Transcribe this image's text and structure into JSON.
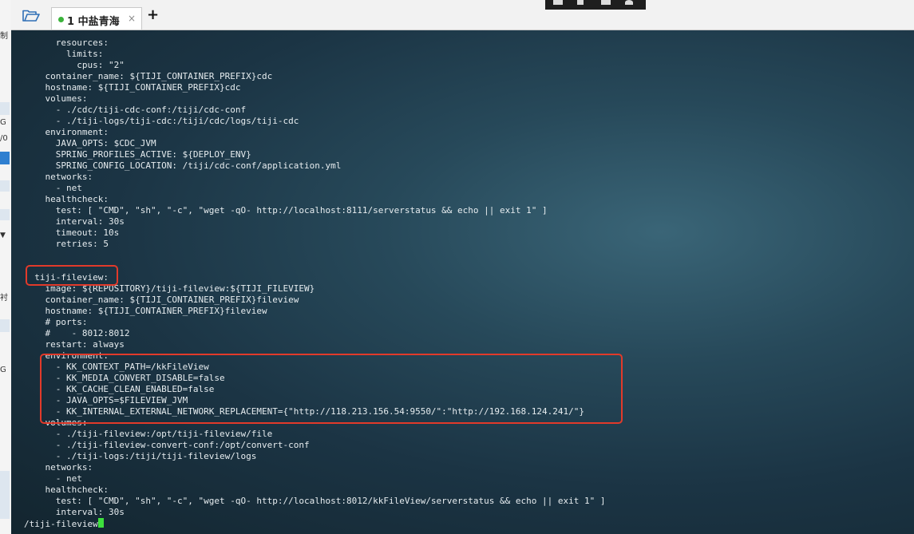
{
  "tabs": [
    {
      "label": "1 中盐青海",
      "active": true,
      "status_color": "#3bb33b"
    }
  ],
  "tab_close_glyph": "×",
  "add_tab_glyph": "+",
  "left_fragments": [
    "制",
    "G",
    "/0",
    "衬",
    "G"
  ],
  "terminal": {
    "lines": [
      "      resources:",
      "        limits:",
      "          cpus: \"2\"",
      "    container_name: ${TIJI_CONTAINER_PREFIX}cdc",
      "    hostname: ${TIJI_CONTAINER_PREFIX}cdc",
      "    volumes:",
      "      - ./cdc/tiji-cdc-conf:/tiji/cdc-conf",
      "      - ./tiji-logs/tiji-cdc:/tiji/cdc/logs/tiji-cdc",
      "    environment:",
      "      JAVA_OPTS: $CDC_JVM",
      "      SPRING_PROFILES_ACTIVE: ${DEPLOY_ENV}",
      "      SPRING_CONFIG_LOCATION: /tiji/cdc-conf/application.yml",
      "    networks:",
      "      - net",
      "    healthcheck:",
      "      test: [ \"CMD\", \"sh\", \"-c\", \"wget -qO- http://localhost:8111/serverstatus && echo || exit 1\" ]",
      "      interval: 30s",
      "      timeout: 10s",
      "      retries: 5",
      "",
      "",
      "  tiji-fileview:",
      "    image: ${REPOSITORY}/tiji-fileview:${TIJI_FILEVIEW}",
      "    container_name: ${TIJI_CONTAINER_PREFIX}fileview",
      "    hostname: ${TIJI_CONTAINER_PREFIX}fileview",
      "    # ports:",
      "    #    - 8012:8012",
      "    restart: always",
      "    environment:",
      "      - KK_CONTEXT_PATH=/kkFileView",
      "      - KK_MEDIA_CONVERT_DISABLE=false",
      "      - KK_CACHE_CLEAN_ENABLED=false",
      "      - JAVA_OPTS=$FILEVIEW_JVM",
      "      - KK_INTERNAL_EXTERNAL_NETWORK_REPLACEMENT={\"http://118.213.156.54:9550/\":\"http://192.168.124.241/\"}",
      "    volumes:",
      "      - ./tiji-fileview:/opt/tiji-fileview/file",
      "      - ./tiji-fileview-convert-conf:/opt/convert-conf",
      "      - ./tiji-logs:/tiji/tiji-fileview/logs",
      "    networks:",
      "      - net",
      "    healthcheck:",
      "      test: [ \"CMD\", \"sh\", \"-c\", \"wget -qO- http://localhost:8012/kkFileView/serverstatus && echo || exit 1\" ]",
      "      interval: 30s",
      "/tiji-fileview"
    ],
    "highlight_color": "#e23a2a",
    "cursor_color": "#3de03d"
  }
}
